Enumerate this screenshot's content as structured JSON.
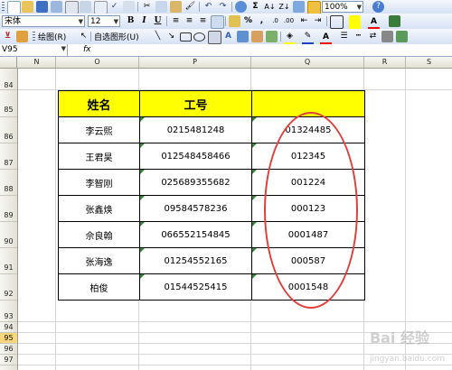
{
  "toolbar": {
    "zoom": "100%",
    "font_name": "宋体",
    "font_size": "12",
    "bold": "B",
    "italic": "I",
    "underline": "U",
    "currency": "%",
    "comma": ",",
    "sigma": "Σ",
    "draw_label": "绘图(R)",
    "autoshape_label": "自选图形(U)",
    "font_color_glyph": "A"
  },
  "formula_bar": {
    "name_box": "V95",
    "fx": "fx"
  },
  "columns": [
    "N",
    "O",
    "P",
    "Q",
    "R",
    "S"
  ],
  "rows": [
    "84",
    "85",
    "86",
    "87",
    "88",
    "89",
    "90",
    "91",
    "92",
    "93",
    "94",
    "95",
    "96",
    "97"
  ],
  "active_row": "95",
  "table": {
    "headers": [
      "姓名",
      "工号",
      ""
    ],
    "rows": [
      [
        "李云熙",
        "0215481248",
        "01324485"
      ],
      [
        "王君昊",
        "012548458466",
        "012345"
      ],
      [
        "李智刚",
        "025689355682",
        "001224"
      ],
      [
        "张鑫焕",
        "09584578236",
        "000123"
      ],
      [
        "佘良翰",
        "066552154845",
        "0001487"
      ],
      [
        "张海逸",
        "01254552165",
        "000587"
      ],
      [
        "柏俊",
        "01544525415",
        "0001548"
      ]
    ]
  },
  "watermark": "Bai 经验",
  "watermark_sub": "jingyan.baidu.com",
  "colors": {
    "header_fill": "#ffff00",
    "oval": "#e0403c",
    "active_row": "#f8d77a"
  }
}
